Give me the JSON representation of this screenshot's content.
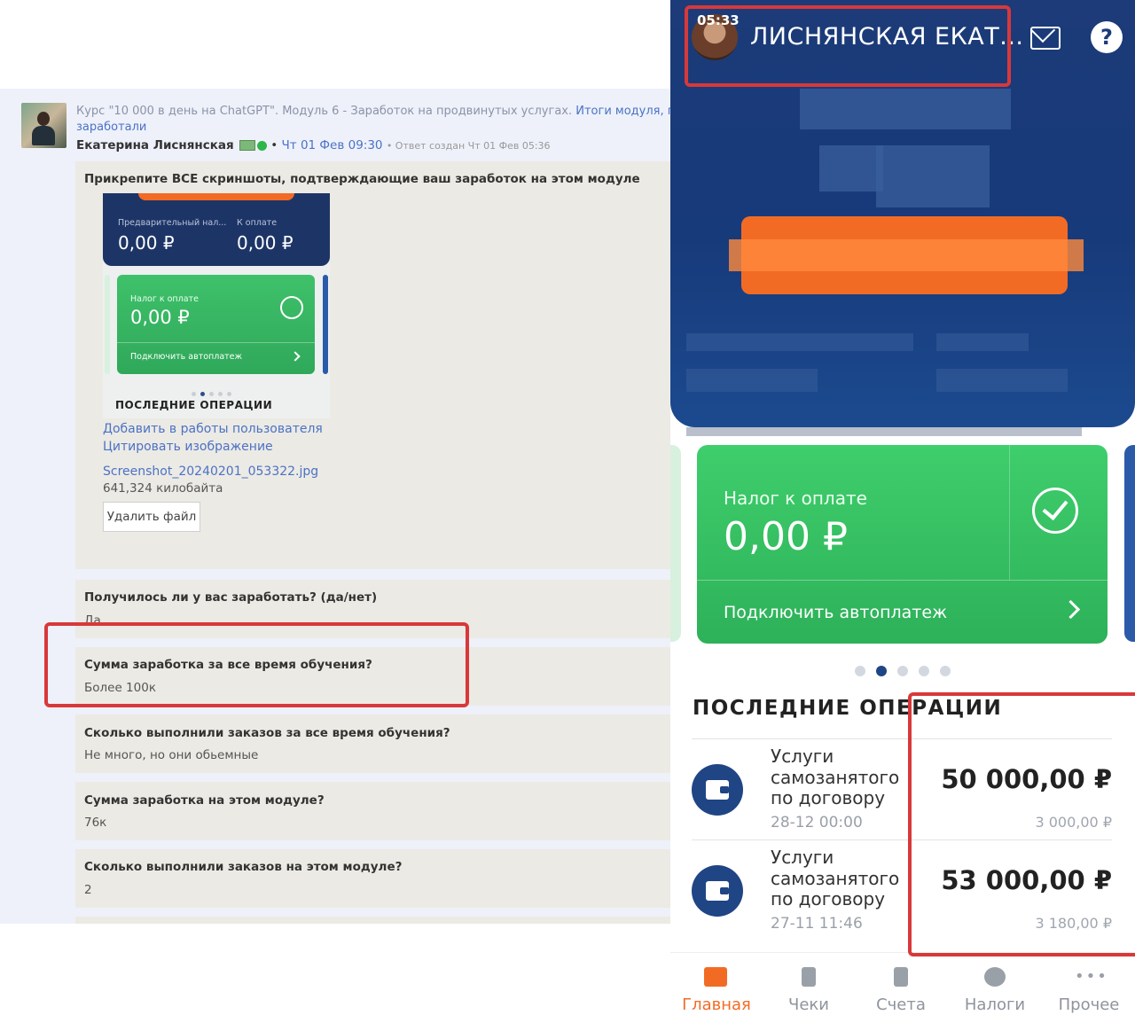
{
  "left": {
    "breadcrumb_course": "Курс \"10 000 в день на ChatGPT\". Модуль 6 - Заработок на продвинутых услугах.",
    "breadcrumb_link": "Итоги модуля, под",
    "breadcrumb_link2": "заработали",
    "author": "Екатерина Лиснянская",
    "bullet": "•",
    "date": "Чт 01 Фев 09:30",
    "meta": "• Ответ создан Чт 01 Фев 05:36",
    "attach_label": "Прикрепите ВСЕ скриншоты, подтверждающие ваш заработок на этом модуле",
    "thumb": {
      "prelim_label": "Предварительный нал...",
      "prelim_value": "0,00 ₽",
      "pay_label": "К оплате",
      "pay_value": "0,00 ₽",
      "tax_label": "Налог к оплате",
      "tax_value": "0,00 ₽",
      "autopay": "Подключить автоплатеж",
      "ops_title": "ПОСЛЕДНИЕ ОПЕРАЦИИ"
    },
    "add_to_works": "Добавить в работы пользователя",
    "quote_image": "Цитировать изображение",
    "filename": "Screenshot_20240201_053322.jpg",
    "filesize": "641,324 килобайта",
    "delete_file": "Удалить файл",
    "questions": [
      {
        "q": "Получилось ли у вас заработать? (да/нет)",
        "a": "Да"
      },
      {
        "q": "Сумма заработка за все время обучения?",
        "a": "Более 100к"
      },
      {
        "q": "Сколько выполнили заказов за все время обучения?",
        "a": "Не много, но они обьемные"
      },
      {
        "q": "Сумма заработка на этом модуле?",
        "a": "76к"
      },
      {
        "q": "Сколько выполнили заказов на этом модуле?",
        "a": "2"
      }
    ]
  },
  "right": {
    "time": "05:33",
    "user_name": "ЛИСНЯНСКАЯ ЕКАТ...",
    "help": "?",
    "card": {
      "tax_label": "Налог к оплате",
      "tax_value": "0,00 ₽",
      "autopay": "Подключить автоплатеж"
    },
    "ops_title": "ПОСЛЕДНИЕ ОПЕРАЦИИ",
    "operations": [
      {
        "name": "Услуги самозанятого по договору",
        "date": "28-12 00:00",
        "amount": "50 000,00 ₽",
        "tax": "3 000,00 ₽"
      },
      {
        "name": "Услуги самозанятого по договору",
        "date": "27-11 11:46",
        "amount": "53 000,00 ₽",
        "tax": "3 180,00 ₽"
      }
    ],
    "nav": [
      "Главная",
      "Чеки",
      "Счета",
      "Налоги",
      "Прочее"
    ]
  },
  "colors": {
    "accent_red": "#d8383a",
    "card_green": "#2db159",
    "header_blue": "#1c3b78",
    "nav_active": "#f26b25"
  }
}
